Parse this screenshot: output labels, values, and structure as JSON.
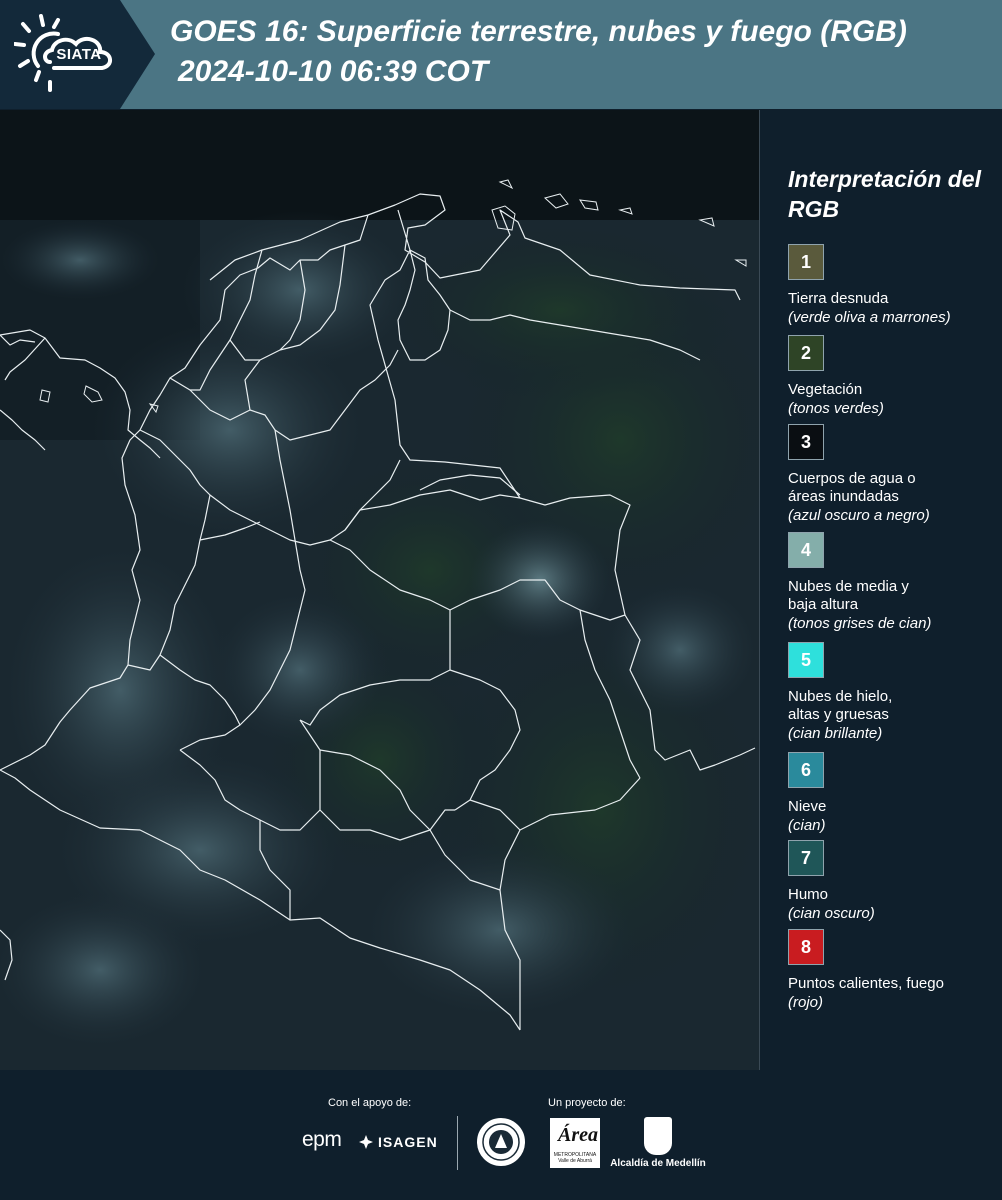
{
  "header": {
    "logo_text": "SIATA",
    "title": "GOES 16: Superficie terrestre, nubes y fuego (RGB)",
    "datetime": "2024-10-10 06:39 COT"
  },
  "map": {
    "image_name": "goes16-rgb-satellite-map-colombia"
  },
  "legend": {
    "title": "Interpretación del RGB",
    "items": [
      {
        "number": "1",
        "label": "Tierra desnuda",
        "desc": "(verde oliva a marrones)",
        "color": "#5a5a3c"
      },
      {
        "number": "2",
        "label": "Vegetación",
        "desc": "(tonos verdes)",
        "color": "#2e4426"
      },
      {
        "number": "3",
        "label": "Cuerpos de agua o\náreas inundadas",
        "desc": "(azul oscuro a negro)",
        "color": "#0a0e12"
      },
      {
        "number": "4",
        "label": "Nubes de media y\nbaja altura",
        "desc": "(tonos grises de cian)",
        "color": "#84aeaa"
      },
      {
        "number": "5",
        "label": "Nubes de hielo,\naltas y gruesas",
        "desc": "(cian brillante)",
        "color": "#2ee0dc"
      },
      {
        "number": "6",
        "label": "Nieve",
        "desc": "(cian)",
        "color": "#2a8a9c"
      },
      {
        "number": "7",
        "label": "Humo",
        "desc": "(cian oscuro)",
        "color": "#1f5658"
      },
      {
        "number": "8",
        "label": "Puntos calientes, fuego",
        "desc": "(rojo)",
        "color": "#c91c20"
      }
    ]
  },
  "footer": {
    "support_label": "Con el apoyo de:",
    "project_label": "Un proyecto de:",
    "epm": "epm",
    "isagen": "ISAGEN",
    "amva_big": "Área",
    "amva_small": "METROPOLITANA Valle de Aburrá",
    "medellin": "Alcaldía de Medellín"
  }
}
